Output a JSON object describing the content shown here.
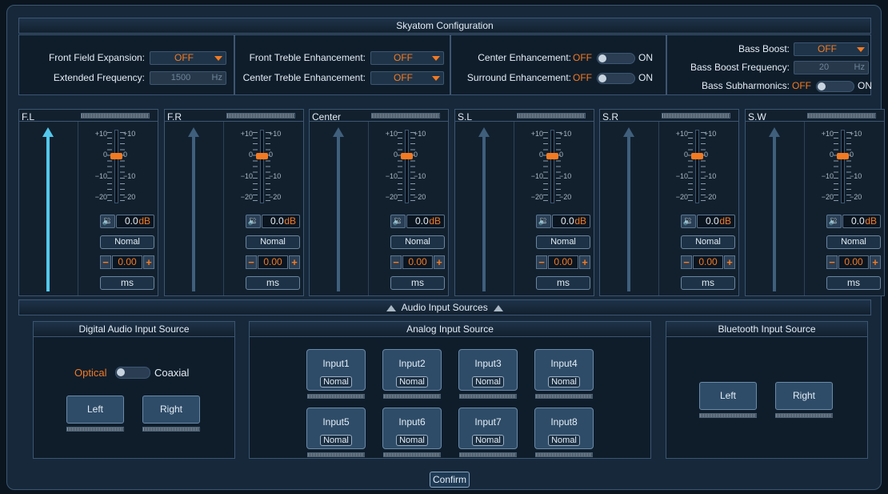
{
  "window": {
    "title": "Skyatom Configuration"
  },
  "config": {
    "front_field_expansion": {
      "label": "Front Field Expansion:",
      "value": "OFF"
    },
    "extended_frequency": {
      "label": "Extended Frequency:",
      "value": "1500",
      "unit": "Hz"
    },
    "front_treble_enhancement": {
      "label": "Front Treble Enhancement:",
      "value": "OFF"
    },
    "center_treble_enhancement": {
      "label": "Center Treble Enhancement:",
      "value": "OFF"
    },
    "center_enhancement": {
      "label": "Center Enhancement:",
      "off": "OFF",
      "on": "ON"
    },
    "surround_enhancement": {
      "label": "Surround Enhancement:",
      "off": "OFF",
      "on": "ON"
    },
    "bass_boost": {
      "label": "Bass Boost:",
      "value": "OFF"
    },
    "bass_boost_frequency": {
      "label": "Bass Boost Frequency:",
      "value": "20",
      "unit": "Hz"
    },
    "bass_subharmonics": {
      "label": "Bass Subharmonics:",
      "off": "OFF",
      "on": "ON"
    }
  },
  "slider_ticks": [
    "+10",
    "0",
    "−10",
    "−20"
  ],
  "channels": [
    {
      "name": "F.L",
      "gain": "0.0",
      "gain_unit": "dB",
      "mode": "Nomal",
      "delay": "0.00",
      "delay_unit": "ms",
      "level_db": 0
    },
    {
      "name": "F.R",
      "gain": "0.0",
      "gain_unit": "dB",
      "mode": "Nomal",
      "delay": "0.00",
      "delay_unit": "ms",
      "level_db": 0
    },
    {
      "name": "Center",
      "gain": "0.0",
      "gain_unit": "dB",
      "mode": "Nomal",
      "delay": "0.00",
      "delay_unit": "ms",
      "level_db": 0
    },
    {
      "name": "S.L",
      "gain": "0.0",
      "gain_unit": "dB",
      "mode": "Nomal",
      "delay": "0.00",
      "delay_unit": "ms",
      "level_db": 0
    },
    {
      "name": "S.R",
      "gain": "0.0",
      "gain_unit": "dB",
      "mode": "Nomal",
      "delay": "0.00",
      "delay_unit": "ms",
      "level_db": 0
    },
    {
      "name": "S.W",
      "gain": "0.0",
      "gain_unit": "dB",
      "mode": "Nomal",
      "delay": "0.00",
      "delay_unit": "ms",
      "level_db": 0
    }
  ],
  "stepper": {
    "minus": "−",
    "plus": "+"
  },
  "audio_sources": {
    "title": "Audio Input Sources",
    "digital": {
      "title": "Digital Audio Input Source",
      "option_a": "Optical",
      "option_b": "Coaxial",
      "left": "Left",
      "right": "Right"
    },
    "analog": {
      "title": "Analog Input Source",
      "inputs": [
        {
          "name": "Input1",
          "mode": "Nomal"
        },
        {
          "name": "Input2",
          "mode": "Nomal"
        },
        {
          "name": "Input3",
          "mode": "Nomal"
        },
        {
          "name": "Input4",
          "mode": "Nomal"
        },
        {
          "name": "Input5",
          "mode": "Nomal"
        },
        {
          "name": "Input6",
          "mode": "Nomal"
        },
        {
          "name": "Input7",
          "mode": "Nomal"
        },
        {
          "name": "Input8",
          "mode": "Nomal"
        }
      ]
    },
    "bluetooth": {
      "title": "Bluetooth Input Source",
      "left": "Left",
      "right": "Right"
    }
  },
  "footer": {
    "confirm": "Confirm"
  },
  "colors": {
    "accent": "#f47a22",
    "active_channel": "#53c8ec",
    "background": "#16283a"
  }
}
